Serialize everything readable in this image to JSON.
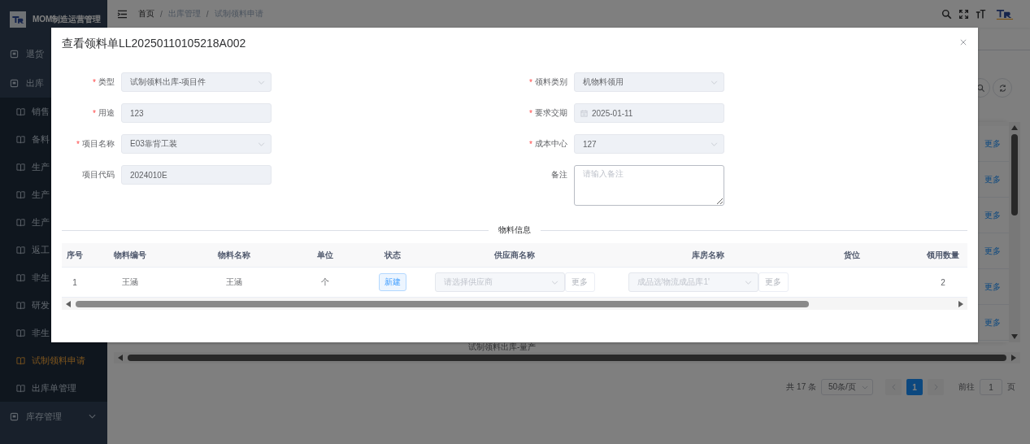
{
  "app": {
    "title": "MOM制造运营管理"
  },
  "sidebar": {
    "items": [
      {
        "label": "退货"
      },
      {
        "label": "出库",
        "children": [
          {
            "label": "销售",
            "selected": false
          },
          {
            "label": "备料",
            "selected": false
          },
          {
            "label": "生产",
            "selected": false
          },
          {
            "label": "生产",
            "selected": false
          },
          {
            "label": "生产",
            "selected": false
          },
          {
            "label": "返工",
            "selected": false
          },
          {
            "label": "非生",
            "selected": false
          },
          {
            "label": "研发",
            "selected": false
          },
          {
            "label": "非生",
            "selected": false
          },
          {
            "label": "试制领料申请",
            "selected": true
          },
          {
            "label": "出库单管理",
            "selected": false
          }
        ]
      },
      {
        "label": "库存管理"
      }
    ]
  },
  "header": {
    "breadcrumb": [
      "首页",
      "出库管理",
      "试制领料申请"
    ],
    "separator": "/"
  },
  "list": {
    "more_links": [
      "更多",
      "更多",
      "更多",
      "更多",
      "更多",
      "更多"
    ],
    "partial_row_text": "试制领料出库-量产"
  },
  "pagination": {
    "total": "共 17 条",
    "page_size": "50条/页",
    "pages": [
      {
        "label": "1",
        "selected": true
      }
    ],
    "goto_label": "前往",
    "goto_value": "1",
    "goto_suffix": "页"
  },
  "dialog": {
    "title": "查看领料单LL20250110105218A002",
    "form": {
      "required_mark": "*",
      "left": [
        {
          "label": "类型",
          "required": true,
          "kind": "select",
          "value": "试制领料出库-项目件",
          "disabled": true
        },
        {
          "label": "用途",
          "required": true,
          "kind": "input",
          "value": "123",
          "disabled": true
        },
        {
          "label": "项目名称",
          "required": true,
          "kind": "select",
          "value": "E03靠背工装",
          "disabled": true
        },
        {
          "label": "项目代码",
          "required": false,
          "kind": "input",
          "value": "2024010E",
          "disabled": true
        }
      ],
      "right": [
        {
          "label": "领料类别",
          "required": true,
          "kind": "select",
          "value": "机物料领用",
          "disabled": true
        },
        {
          "label": "要求交期",
          "required": true,
          "kind": "date",
          "value": "2025-01-11",
          "disabled": true
        },
        {
          "label": "成本中心",
          "required": true,
          "kind": "select",
          "value": "127",
          "disabled": true
        },
        {
          "label": "备注",
          "required": false,
          "kind": "textarea",
          "placeholder": "请输入备注",
          "disabled": false
        }
      ]
    },
    "section_title": "物料信息",
    "table": {
      "columns": [
        "序号",
        "物料编号",
        "物料名称",
        "单位",
        "状态",
        "供应商名称",
        "库房名称",
        "货位",
        "领用数量"
      ],
      "rows": [
        {
          "cells": [
            {
              "kind": "text",
              "text": "1"
            },
            {
              "kind": "text",
              "text": "王涵"
            },
            {
              "kind": "text",
              "text": "王涵"
            },
            {
              "kind": "text",
              "text": "个"
            },
            {
              "kind": "tag",
              "text": "新建"
            },
            {
              "kind": "picker",
              "placeholder": "请选择供应商",
              "more": "更多"
            },
            {
              "kind": "picker",
              "placeholder": "成品选'物流成品库1'",
              "more": "更多"
            },
            {
              "kind": "empty"
            },
            {
              "kind": "text",
              "text": "2"
            }
          ]
        }
      ]
    }
  }
}
